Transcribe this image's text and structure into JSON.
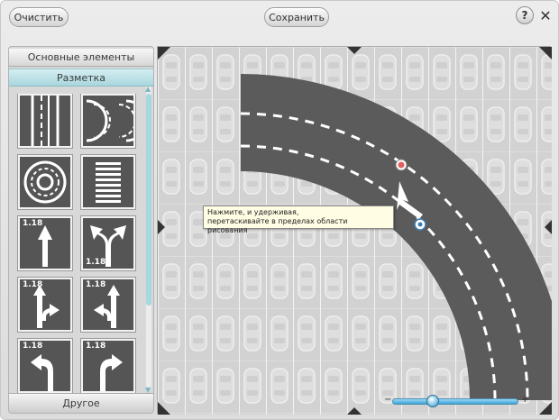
{
  "toolbar": {
    "clear_label": "Очистить",
    "save_label": "Сохранить",
    "help_label": "?",
    "close_label": "✕"
  },
  "sidebar": {
    "header_basic": "Основные элементы",
    "header_markings": "Разметка",
    "header_other": "Другое",
    "tile_labels": [
      "1.18",
      "1.18",
      "1.18",
      "1.18",
      "1.18",
      "1.18"
    ]
  },
  "canvas": {
    "tooltip_line1": "Нажмите, и удерживая,",
    "tooltip_line2": "перетаскивайте в пределах области рисования"
  },
  "zoom": {
    "minus": "−",
    "plus": "+",
    "value": 0.3
  },
  "colors": {
    "road": "#5a5a5a",
    "accent": "#a9d6dd",
    "zoom": "#3aa4d6"
  }
}
